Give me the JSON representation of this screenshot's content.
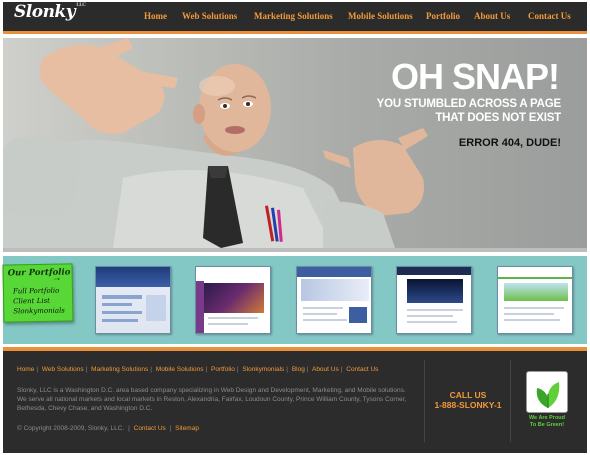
{
  "header": {
    "logo": "Slonky",
    "logo_mark": "LLC",
    "nav": [
      "Home",
      "Web Solutions",
      "Marketing Solutions",
      "Mobile Solutions",
      "Portfolio",
      "About Us",
      "Contact Us"
    ]
  },
  "hero": {
    "title": "OH SNAP!",
    "subtitle_line1": "YOU STUMBLED ACROSS A PAGE",
    "subtitle_line2": "THAT DOES NOT EXIST",
    "error": "ERROR 404, DUDE!"
  },
  "portfolio": {
    "title": "Our Portfolio",
    "links": [
      "Full Portfolio",
      "Client List",
      "Slonkymonials"
    ],
    "thumbnail_count": 5
  },
  "footer": {
    "nav": [
      "Home",
      "Web Solutions",
      "Marketing Solutions",
      "Mobile Solutions",
      "Portfolio",
      "Slonkymonials",
      "Blog",
      "About Us",
      "Contact Us"
    ],
    "description": "Slonky, LLC is a Washington D.C. area based company specializing in Web Design and Development, Marketing, and Mobile solutions. We serve all national markets and local markets in Reston, Alexandria, Fairfax, Loudoun County, Prince William County, Tysons Corner, Bethesda, Chevy Chase, and Washington D.C.",
    "copyright": "© Copyright 2008-2009, Slonky, LLC.",
    "copy_links": [
      "Contact Us",
      "Sitemap"
    ],
    "call_label": "CALL US",
    "phone": "1-888-SLONKY-1",
    "green_text_line1": "We Are Proud",
    "green_text_line2": "To Be Green!"
  },
  "colors": {
    "accent": "#e8913a",
    "header_bg": "#2b2b2b",
    "strip_bg": "#84c8c6",
    "note_green": "#58d836"
  }
}
